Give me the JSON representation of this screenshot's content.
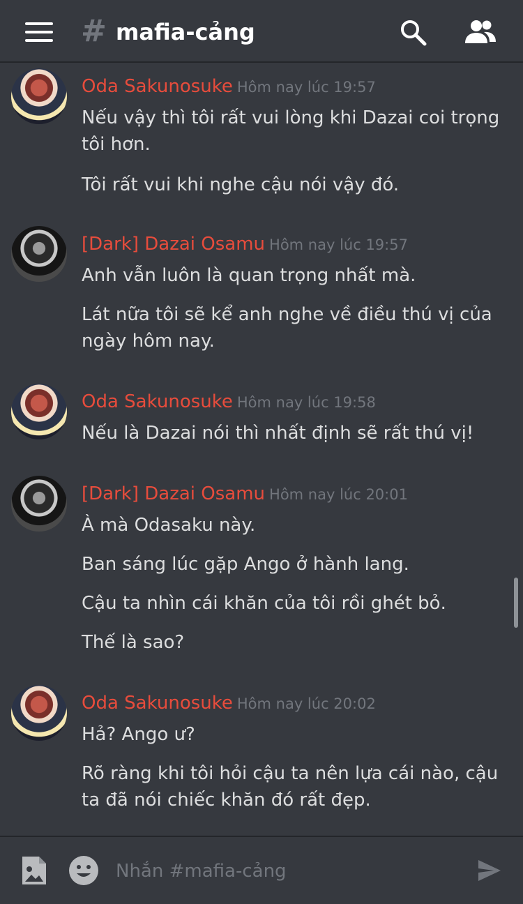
{
  "header": {
    "channel_name": "mafia-cảng",
    "hash_symbol": "#"
  },
  "messages": [
    {
      "author": "Oda Sakunosuke",
      "avatar": "oda-avatar",
      "timestamp": "Hôm nay lúc 19:57",
      "lines": [
        "Nếu vậy thì tôi rất vui lòng khi Dazai coi trọng tôi hơn.",
        "Tôi rất vui khi nghe cậu nói vậy đó."
      ]
    },
    {
      "author": "[Dark] Dazai Osamu",
      "avatar": "dazai-avatar",
      "timestamp": "Hôm nay lúc 19:57",
      "lines": [
        "Anh vẫn luôn là quan trọng nhất mà.",
        "Lát nữa tôi sẽ kể anh nghe về điều thú vị của ngày hôm nay."
      ]
    },
    {
      "author": "Oda Sakunosuke",
      "avatar": "oda-avatar",
      "timestamp": "Hôm nay lúc 19:58",
      "lines": [
        "Nếu là Dazai nói thì nhất định sẽ rất thú vị!"
      ]
    },
    {
      "author": "[Dark] Dazai Osamu",
      "avatar": "dazai-avatar",
      "timestamp": "Hôm nay lúc 20:01",
      "lines": [
        "À mà Odasaku này.",
        "Ban sáng lúc gặp Ango ở hành lang.",
        "Cậu ta nhìn cái khăn của tôi rồi ghét bỏ.",
        "Thế là sao?"
      ]
    },
    {
      "author": "Oda Sakunosuke",
      "avatar": "oda-avatar",
      "timestamp": "Hôm nay lúc 20:02",
      "lines": [
        "Hả? Ango ư?",
        "Rõ ràng khi tôi hỏi cậu ta nên lựa cái nào, cậu ta đã nói chiếc khăn đó rất đẹp."
      ]
    }
  ],
  "composer": {
    "placeholder": "Nhắn #mafia-cảng"
  },
  "colors": {
    "background": "#36393f",
    "author_name": "#e74c3c",
    "timestamp": "#72767d",
    "message_text": "#dcddde"
  },
  "icons": [
    "hamburger-menu-icon",
    "search-icon",
    "members-icon",
    "image-upload-icon",
    "emoji-icon",
    "send-icon"
  ]
}
